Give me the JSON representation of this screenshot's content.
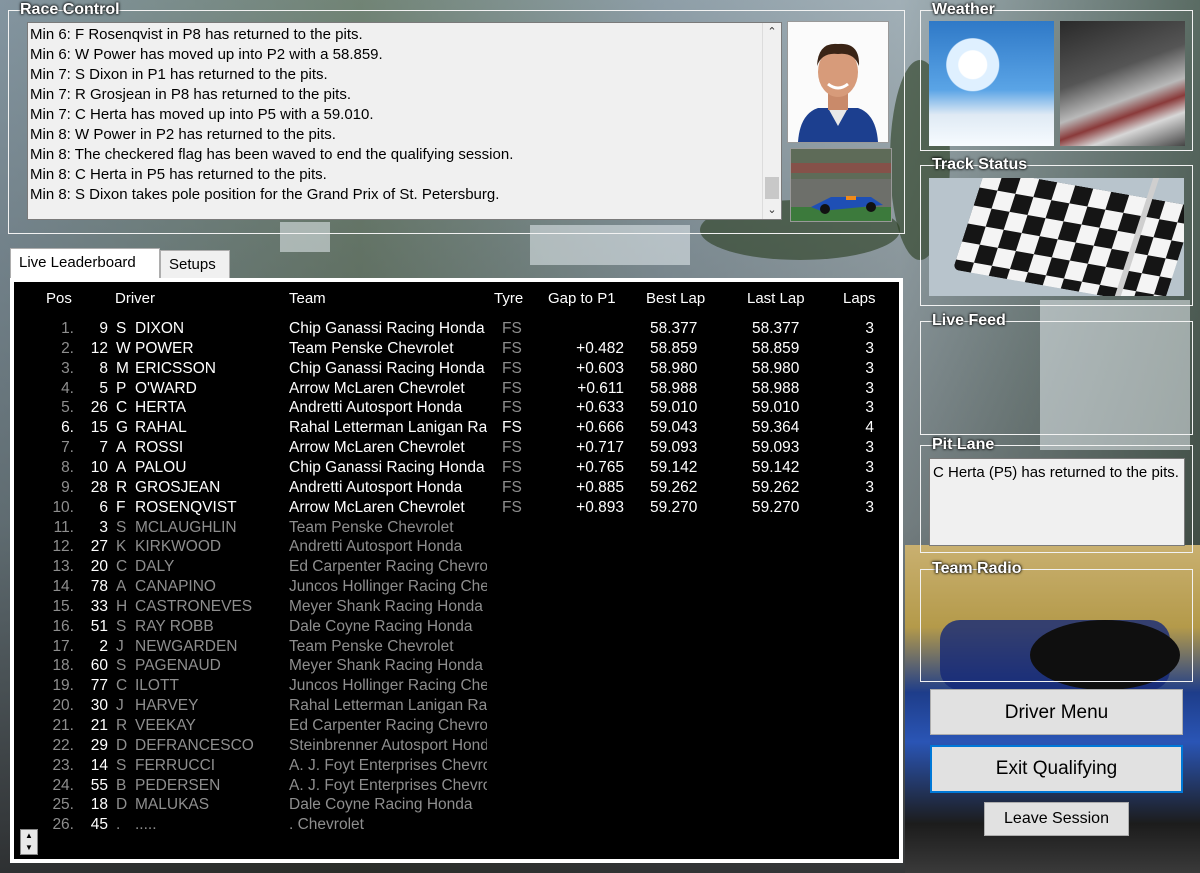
{
  "race_control": {
    "title": "Race Control",
    "messages": [
      "Min 6: F Rosenqvist in P8 has returned to the pits.",
      "Min 6: W Power has moved up into P2 with a 58.859.",
      "Min 7: S Dixon in P1 has returned to the pits.",
      "Min 7: R Grosjean in P8 has returned to the pits.",
      "Min 7: C Herta has moved up into P5 with a 59.010.",
      "Min 8: W Power in P2 has returned to the pits.",
      "Min 8: The checkered flag has been waved to end the qualifying session.",
      "Min 8: C Herta in P5 has returned to the pits.",
      "Min 8: S Dixon takes pole position for the Grand Prix of St. Petersburg."
    ]
  },
  "tabs": [
    {
      "label": "Live Leaderboard",
      "active": true
    },
    {
      "label": "Setups",
      "active": false
    }
  ],
  "leaderboard": {
    "headers": {
      "pos": "Pos",
      "driver": "Driver",
      "team": "Team",
      "tyre": "Tyre",
      "gap": "Gap to P1",
      "best": "Best Lap",
      "last": "Last Lap",
      "laps": "Laps"
    },
    "rows": [
      {
        "pos": "1.",
        "num": "9",
        "ini": "S",
        "name": "DIXON",
        "team": "Chip Ganassi Racing Honda",
        "tyre": "FS",
        "gap": "",
        "best": "58.377",
        "last": "58.377",
        "laps": "3",
        "active": true
      },
      {
        "pos": "2.",
        "num": "12",
        "ini": "W",
        "name": "POWER",
        "team": "Team Penske Chevrolet",
        "tyre": "FS",
        "gap": "+0.482",
        "best": "58.859",
        "last": "58.859",
        "laps": "3",
        "active": true
      },
      {
        "pos": "3.",
        "num": "8",
        "ini": "M",
        "name": "ERICSSON",
        "team": "Chip Ganassi Racing Honda",
        "tyre": "FS",
        "gap": "+0.603",
        "best": "58.980",
        "last": "58.980",
        "laps": "3",
        "active": true
      },
      {
        "pos": "4.",
        "num": "5",
        "ini": "P",
        "name": "O'WARD",
        "team": "Arrow McLaren Chevrolet",
        "tyre": "FS",
        "gap": "+0.611",
        "best": "58.988",
        "last": "58.988",
        "laps": "3",
        "active": true
      },
      {
        "pos": "5.",
        "num": "26",
        "ini": "C",
        "name": "HERTA",
        "team": "Andretti Autosport Honda",
        "tyre": "FS",
        "gap": "+0.633",
        "best": "59.010",
        "last": "59.010",
        "laps": "3",
        "active": true
      },
      {
        "pos": "6.",
        "num": "15",
        "ini": "G",
        "name": "RAHAL",
        "team": "Rahal Letterman Lanigan Racing",
        "tyre": "FS",
        "gap": "+0.666",
        "best": "59.043",
        "last": "59.364",
        "laps": "4",
        "active": true,
        "onTrack": true
      },
      {
        "pos": "7.",
        "num": "7",
        "ini": "A",
        "name": "ROSSI",
        "team": "Arrow McLaren Chevrolet",
        "tyre": "FS",
        "gap": "+0.717",
        "best": "59.093",
        "last": "59.093",
        "laps": "3",
        "active": true
      },
      {
        "pos": "8.",
        "num": "10",
        "ini": "A",
        "name": "PALOU",
        "team": "Chip Ganassi Racing Honda",
        "tyre": "FS",
        "gap": "+0.765",
        "best": "59.142",
        "last": "59.142",
        "laps": "3",
        "active": true
      },
      {
        "pos": "9.",
        "num": "28",
        "ini": "R",
        "name": "GROSJEAN",
        "team": "Andretti Autosport Honda",
        "tyre": "FS",
        "gap": "+0.885",
        "best": "59.262",
        "last": "59.262",
        "laps": "3",
        "active": true
      },
      {
        "pos": "10.",
        "num": "6",
        "ini": "F",
        "name": "ROSENQVIST",
        "team": "Arrow McLaren Chevrolet",
        "tyre": "FS",
        "gap": "+0.893",
        "best": "59.270",
        "last": "59.270",
        "laps": "3",
        "active": true
      },
      {
        "pos": "11.",
        "num": "3",
        "ini": "S",
        "name": "MCLAUGHLIN",
        "team": "Team Penske Chevrolet",
        "active": false
      },
      {
        "pos": "12.",
        "num": "27",
        "ini": "K",
        "name": "KIRKWOOD",
        "team": "Andretti Autosport Honda",
        "active": false
      },
      {
        "pos": "13.",
        "num": "20",
        "ini": "C",
        "name": "DALY",
        "team": "Ed Carpenter Racing Chevrolet",
        "active": false
      },
      {
        "pos": "14.",
        "num": "78",
        "ini": "A",
        "name": "CANAPINO",
        "team": "Juncos Hollinger Racing Chevrolet",
        "active": false
      },
      {
        "pos": "15.",
        "num": "33",
        "ini": "H",
        "name": "CASTRONEVES",
        "team": "Meyer Shank Racing Honda",
        "active": false
      },
      {
        "pos": "16.",
        "num": "51",
        "ini": "S",
        "name": "RAY ROBB",
        "team": "Dale Coyne Racing Honda",
        "active": false
      },
      {
        "pos": "17.",
        "num": "2",
        "ini": "J",
        "name": "NEWGARDEN",
        "team": "Team Penske Chevrolet",
        "active": false
      },
      {
        "pos": "18.",
        "num": "60",
        "ini": "S",
        "name": "PAGENAUD",
        "team": "Meyer Shank Racing Honda",
        "active": false
      },
      {
        "pos": "19.",
        "num": "77",
        "ini": "C",
        "name": "ILOTT",
        "team": "Juncos Hollinger Racing Chevrolet",
        "active": false
      },
      {
        "pos": "20.",
        "num": "30",
        "ini": "J",
        "name": "HARVEY",
        "team": "Rahal Letterman Lanigan Racing",
        "active": false
      },
      {
        "pos": "21.",
        "num": "21",
        "ini": "R",
        "name": "VEEKAY",
        "team": "Ed Carpenter Racing Chevrolet",
        "active": false
      },
      {
        "pos": "22.",
        "num": "29",
        "ini": "D",
        "name": "DEFRANCESCO",
        "team": "Steinbrenner Autosport Honda",
        "active": false
      },
      {
        "pos": "23.",
        "num": "14",
        "ini": "S",
        "name": "FERRUCCI",
        "team": "A. J. Foyt Enterprises Chevrolet",
        "active": false
      },
      {
        "pos": "24.",
        "num": "55",
        "ini": "B",
        "name": "PEDERSEN",
        "team": "A. J. Foyt Enterprises Chevrolet",
        "active": false
      },
      {
        "pos": "25.",
        "num": "18",
        "ini": "D",
        "name": "MALUKAS",
        "team": "Dale Coyne Racing Honda",
        "active": false
      },
      {
        "pos": "26.",
        "num": "45",
        "ini": ".",
        "name": ".....",
        "team": ". Chevrolet",
        "active": false
      }
    ]
  },
  "weather": {
    "title": "Weather"
  },
  "track_status": {
    "title": "Track Status"
  },
  "live_feed": {
    "title": "Live Feed"
  },
  "pit_lane": {
    "title": "Pit Lane",
    "message": "C Herta (P5) has returned to the pits."
  },
  "team_radio": {
    "title": "Team Radio"
  },
  "buttons": {
    "driver_menu": "Driver Menu",
    "exit_qualifying": "Exit Qualifying",
    "leave_session": "Leave Session"
  }
}
